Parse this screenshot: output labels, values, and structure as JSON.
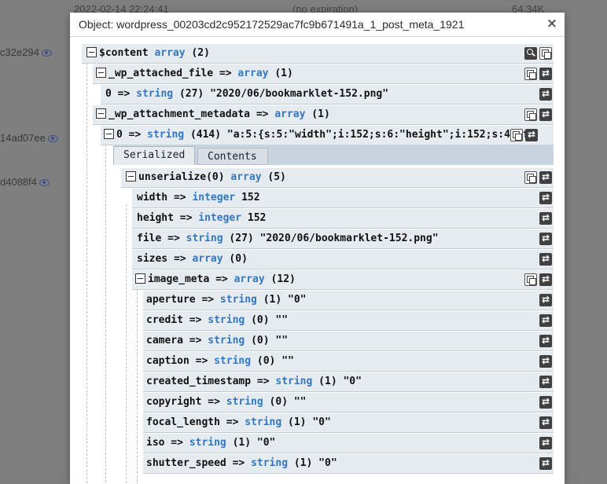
{
  "background": {
    "top_timestamp": "2022-02-14 22:24:41",
    "top_expiration": "(no expiration)",
    "top_size": "64.34K",
    "row_ids": [
      "c32e294",
      "14ad07ee",
      "d4088f4"
    ]
  },
  "modal": {
    "title": "Object: wordpress_00203cd2c952172529ac7fc9b671491a_1_post_meta_1921",
    "close_label": "×"
  },
  "tree": {
    "root": {
      "key": "$content",
      "type": "array",
      "value": "(2)"
    },
    "attached_file": {
      "key": "_wp_attached_file =>",
      "type": "array",
      "value": "(1)"
    },
    "attached_file_0": {
      "key": "0 =>",
      "type": "string",
      "value": "(27) \"2020/06/bookmarklet-152.png\""
    },
    "attachment_metadata": {
      "key": "_wp_attachment_metadata =>",
      "type": "array",
      "value": "(1)"
    },
    "metadata_0": {
      "key": "0 =>",
      "type": "string",
      "value": "(414) \"a:5:{s:5:\"width\";i:152;s:6:\"height\";i:152;s:4:\"fi"
    },
    "tabs": [
      "Serialized",
      "Contents"
    ],
    "unserialize": {
      "key": "unserialize(0)",
      "type": "array",
      "value": "(5)"
    },
    "width": {
      "key": "width =>",
      "type": "integer",
      "value": "152"
    },
    "height": {
      "key": "height =>",
      "type": "integer",
      "value": "152"
    },
    "file": {
      "key": "file =>",
      "type": "string",
      "value": "(27) \"2020/06/bookmarklet-152.png\""
    },
    "sizes": {
      "key": "sizes =>",
      "type": "array",
      "value": "(0)"
    },
    "image_meta": {
      "key": "image_meta =>",
      "type": "array",
      "value": "(12)"
    },
    "meta_items": [
      {
        "key": "aperture =>",
        "type": "string",
        "value": "(1) \"0\""
      },
      {
        "key": "credit =>",
        "type": "string",
        "value": "(0) \"\""
      },
      {
        "key": "camera =>",
        "type": "string",
        "value": "(0) \"\""
      },
      {
        "key": "caption =>",
        "type": "string",
        "value": "(0) \"\""
      },
      {
        "key": "created_timestamp =>",
        "type": "string",
        "value": "(1) \"0\""
      },
      {
        "key": "copyright =>",
        "type": "string",
        "value": "(0) \"\""
      },
      {
        "key": "focal_length =>",
        "type": "string",
        "value": "(1) \"0\""
      },
      {
        "key": "iso =>",
        "type": "string",
        "value": "(1) \"0\""
      },
      {
        "key": "shutter_speed =>",
        "type": "string",
        "value": "(1) \"0\""
      }
    ]
  }
}
